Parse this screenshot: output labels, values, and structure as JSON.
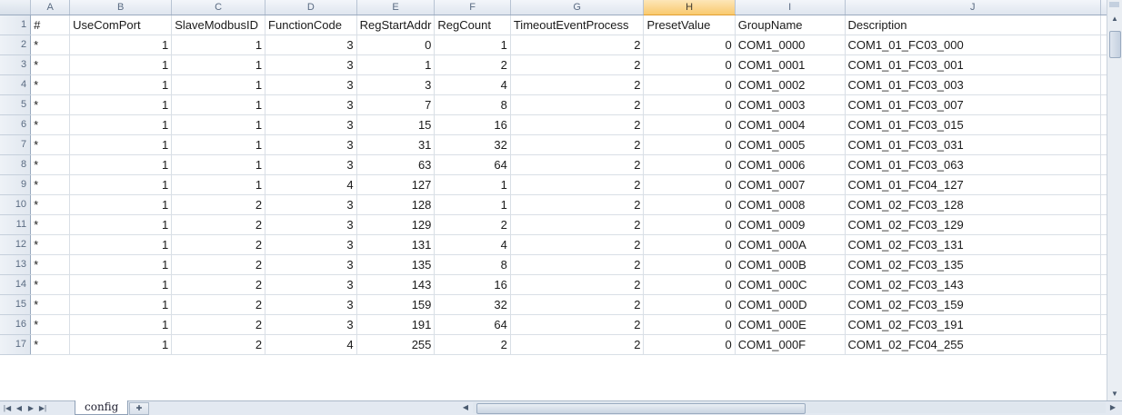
{
  "spreadsheet": {
    "column_headers": [
      "A",
      "B",
      "C",
      "D",
      "E",
      "F",
      "G",
      "H",
      "I",
      "J"
    ],
    "selected_column": "H",
    "rows": [
      {
        "n": "1",
        "cells": [
          "#",
          "UseComPort",
          "SlaveModbusID",
          "FunctionCode",
          "RegStartAddr",
          "RegCount",
          "TimeoutEventProcess",
          "PresetValue",
          "GroupName",
          "Description"
        ]
      },
      {
        "n": "2",
        "cells": [
          "*",
          "1",
          "1",
          "3",
          "0",
          "1",
          "2",
          "0",
          "COM1_0000",
          "COM1_01_FC03_000"
        ]
      },
      {
        "n": "3",
        "cells": [
          "*",
          "1",
          "1",
          "3",
          "1",
          "2",
          "2",
          "0",
          "COM1_0001",
          "COM1_01_FC03_001"
        ]
      },
      {
        "n": "4",
        "cells": [
          "*",
          "1",
          "1",
          "3",
          "3",
          "4",
          "2",
          "0",
          "COM1_0002",
          "COM1_01_FC03_003"
        ]
      },
      {
        "n": "5",
        "cells": [
          "*",
          "1",
          "1",
          "3",
          "7",
          "8",
          "2",
          "0",
          "COM1_0003",
          "COM1_01_FC03_007"
        ]
      },
      {
        "n": "6",
        "cells": [
          "*",
          "1",
          "1",
          "3",
          "15",
          "16",
          "2",
          "0",
          "COM1_0004",
          "COM1_01_FC03_015"
        ]
      },
      {
        "n": "7",
        "cells": [
          "*",
          "1",
          "1",
          "3",
          "31",
          "32",
          "2",
          "0",
          "COM1_0005",
          "COM1_01_FC03_031"
        ]
      },
      {
        "n": "8",
        "cells": [
          "*",
          "1",
          "1",
          "3",
          "63",
          "64",
          "2",
          "0",
          "COM1_0006",
          "COM1_01_FC03_063"
        ]
      },
      {
        "n": "9",
        "cells": [
          "*",
          "1",
          "1",
          "4",
          "127",
          "1",
          "2",
          "0",
          "COM1_0007",
          "COM1_01_FC04_127"
        ]
      },
      {
        "n": "10",
        "cells": [
          "*",
          "1",
          "2",
          "3",
          "128",
          "1",
          "2",
          "0",
          "COM1_0008",
          "COM1_02_FC03_128"
        ]
      },
      {
        "n": "11",
        "cells": [
          "*",
          "1",
          "2",
          "3",
          "129",
          "2",
          "2",
          "0",
          "COM1_0009",
          "COM1_02_FC03_129"
        ]
      },
      {
        "n": "12",
        "cells": [
          "*",
          "1",
          "2",
          "3",
          "131",
          "4",
          "2",
          "0",
          "COM1_000A",
          "COM1_02_FC03_131"
        ]
      },
      {
        "n": "13",
        "cells": [
          "*",
          "1",
          "2",
          "3",
          "135",
          "8",
          "2",
          "0",
          "COM1_000B",
          "COM1_02_FC03_135"
        ]
      },
      {
        "n": "14",
        "cells": [
          "*",
          "1",
          "2",
          "3",
          "143",
          "16",
          "2",
          "0",
          "COM1_000C",
          "COM1_02_FC03_143"
        ]
      },
      {
        "n": "15",
        "cells": [
          "*",
          "1",
          "2",
          "3",
          "159",
          "32",
          "2",
          "0",
          "COM1_000D",
          "COM1_02_FC03_159"
        ]
      },
      {
        "n": "16",
        "cells": [
          "*",
          "1",
          "2",
          "3",
          "191",
          "64",
          "2",
          "0",
          "COM1_000E",
          "COM1_02_FC03_191"
        ]
      },
      {
        "n": "17",
        "cells": [
          "*",
          "1",
          "2",
          "4",
          "255",
          "2",
          "2",
          "0",
          "COM1_000F",
          "COM1_02_FC04_255"
        ]
      }
    ]
  },
  "sheet_tabs": [
    {
      "label": "config",
      "active": true
    }
  ],
  "icons": {
    "nav_first": "nav-first-icon",
    "nav_prev": "nav-prev-icon",
    "nav_next": "nav-next-icon",
    "nav_last": "nav-last-icon",
    "new_sheet": "new-sheet-icon"
  },
  "colors": {
    "selected_column_header": "#f9c96e",
    "header_bg": "#dfe6ef",
    "gridline": "#d9dfe6"
  }
}
